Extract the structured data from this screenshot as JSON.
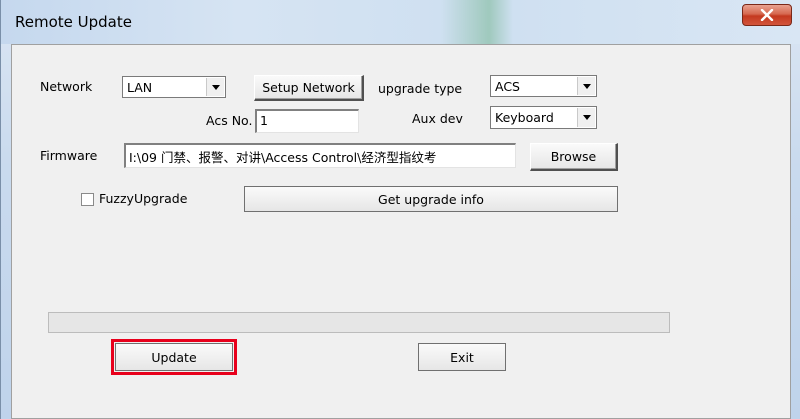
{
  "window": {
    "title": "Remote Update",
    "close_icon": "close-x-icon"
  },
  "form": {
    "network_label": "Network",
    "network_value": "LAN",
    "setup_network_label": "Setup Network",
    "upgrade_type_label": "upgrade type",
    "upgrade_type_value": "ACS",
    "acs_no_label": "Acs No.",
    "acs_no_value": "1",
    "aux_dev_label": "Aux dev",
    "aux_dev_value": "Keyboard",
    "firmware_label": "Firmware",
    "firmware_value": "I:\\09 门禁、报警、对讲\\Access Control\\经济型指纹考",
    "browse_label": "Browse",
    "fuzzy_upgrade_label": "FuzzyUpgrade",
    "fuzzy_upgrade_checked": false,
    "get_upgrade_info_label": "Get upgrade info",
    "progress_value": 0,
    "update_label": "Update",
    "exit_label": "Exit"
  },
  "colors": {
    "highlight": "#e8001c",
    "close_button": "#c4391f"
  }
}
